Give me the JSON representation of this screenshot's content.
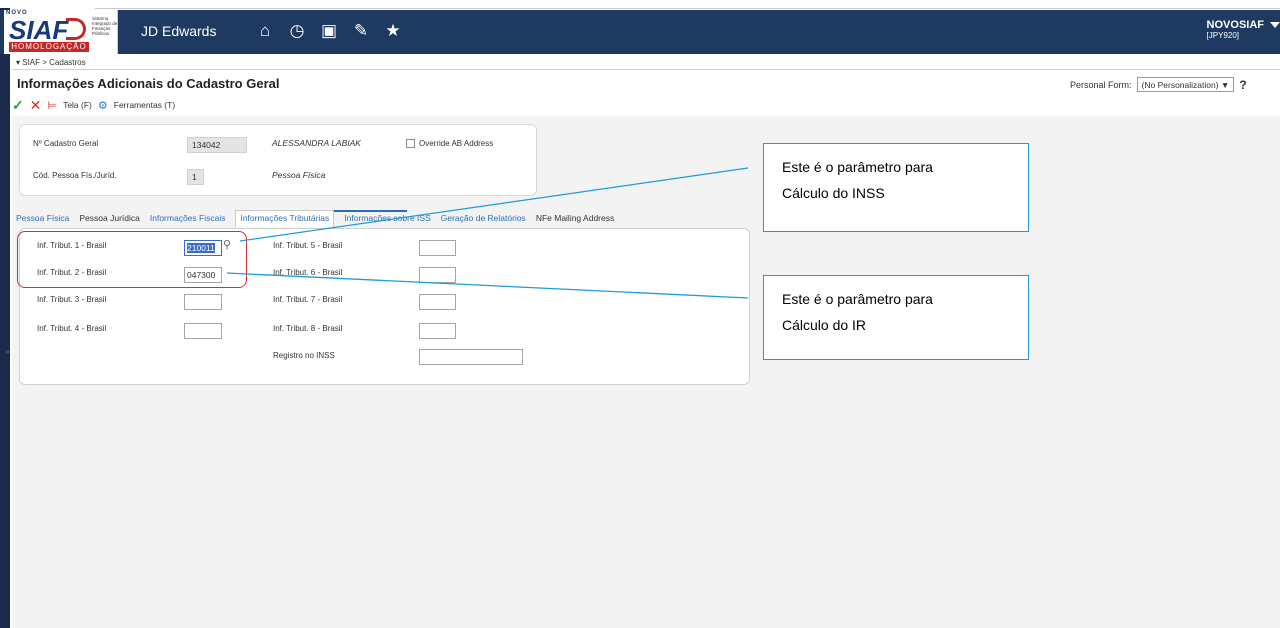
{
  "header": {
    "logo_top": "NOVO",
    "logo_name": "SIAF",
    "logo_tagline": "Sistema Integrado de Finanças Públicas",
    "logo_env_badge": "HOMOLOGAÇÃO",
    "app_name": "JD Edwards",
    "icons": [
      "home-icon",
      "recent-icon",
      "chart-icon",
      "edit-icon",
      "favorites-icon"
    ],
    "user": "NOVOSIAF",
    "environment": "[JPY920]"
  },
  "breadcrumb": "▾ SIAF  >  Cadastros",
  "form": {
    "title": "Informações Adicionais do Cadastro Geral",
    "personal_form_label": "Personal Form:",
    "personal_form_value": "(No Personalization) ▼",
    "help": "?"
  },
  "toolbar": {
    "ok": "✓",
    "cancel": "✕",
    "tela": "Tela (F)",
    "ferramentas": "Ferramentas (T)"
  },
  "header_fields": {
    "cadastro_label": "Nº Cadastro Geral",
    "cadastro_value": "134042",
    "cadastro_name": "ALESSANDRA LABIAK",
    "override_label": "Override AB Address",
    "pessoa_label": "Cód. Pessoa Fís./Juríd.",
    "pessoa_value": "1",
    "pessoa_desc": "Pessoa Física"
  },
  "tabs": [
    "Pessoa Física",
    "Pessoa Jurídica",
    "Informações Fiscais",
    "Informações Tributárias",
    "Informações sobre ISS",
    "Geração de Relatórios",
    "NFe Mailing Address"
  ],
  "fields": {
    "trib1_label": "Inf. Tribut. 1 - Brasil",
    "trib1_value": "210011",
    "trib2_label": "Inf. Tribut. 2 - Brasil",
    "trib2_value": "047300",
    "trib3_label": "Inf. Tribut. 3 - Brasil",
    "trib4_label": "Inf. Tribut. 4 - Brasil",
    "trib5_label": "Inf. Tribut. 5 - Brasil",
    "trib6_label": "Inf. Tribut. 6 - Brasil",
    "trib7_label": "Inf. Tribut. 7 - Brasil",
    "trib8_label": "Inf. Tribut. 8 - Brasil",
    "inss_label": "Registro no INSS"
  },
  "callouts": {
    "inss_line1": "Este é o parâmetro para",
    "inss_line2": "Cálculo do INSS",
    "ir_line1": "Este é o parâmetro para",
    "ir_line2": "Cálculo do IR"
  },
  "colors": {
    "header_bg": "#1e3a60",
    "link_blue": "#2a6ebb",
    "callout_border": "#1f9bd8",
    "highlight_red": "#d32f2f"
  }
}
